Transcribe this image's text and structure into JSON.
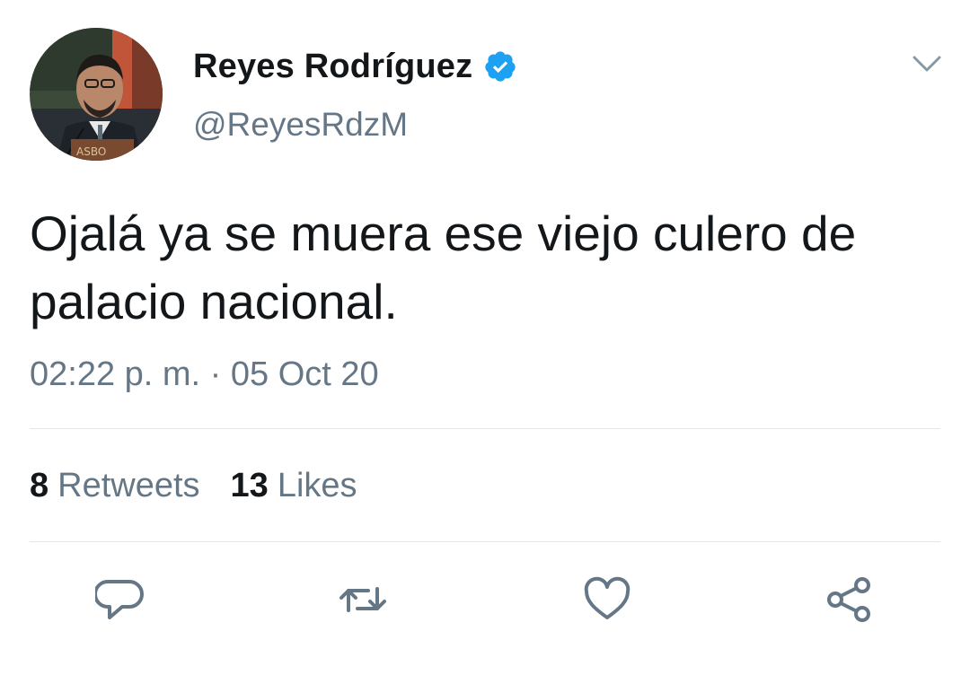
{
  "author": {
    "display_name": "Reyes Rodríguez",
    "handle": "@ReyesRdzM",
    "verified": true
  },
  "tweet": {
    "text_line1": "Ojalá ya se muera ese viejo culero de",
    "text_line2": "palacio nacional.",
    "timestamp": "02:22 p. m. · 05 Oct 20"
  },
  "stats": {
    "retweets_count": "8",
    "retweets_label": "Retweets",
    "likes_count": "13",
    "likes_label": "Likes"
  },
  "icons": {
    "verified": "verified-badge-icon",
    "menu": "chevron-down-icon",
    "reply": "reply-icon",
    "retweet": "retweet-icon",
    "like": "heart-icon",
    "share": "share-icon"
  },
  "colors": {
    "text": "#14171a",
    "secondary": "#657786",
    "verified_blue": "#1da1f2",
    "icon_gray": "#657786",
    "divider": "#e1e8ed"
  }
}
